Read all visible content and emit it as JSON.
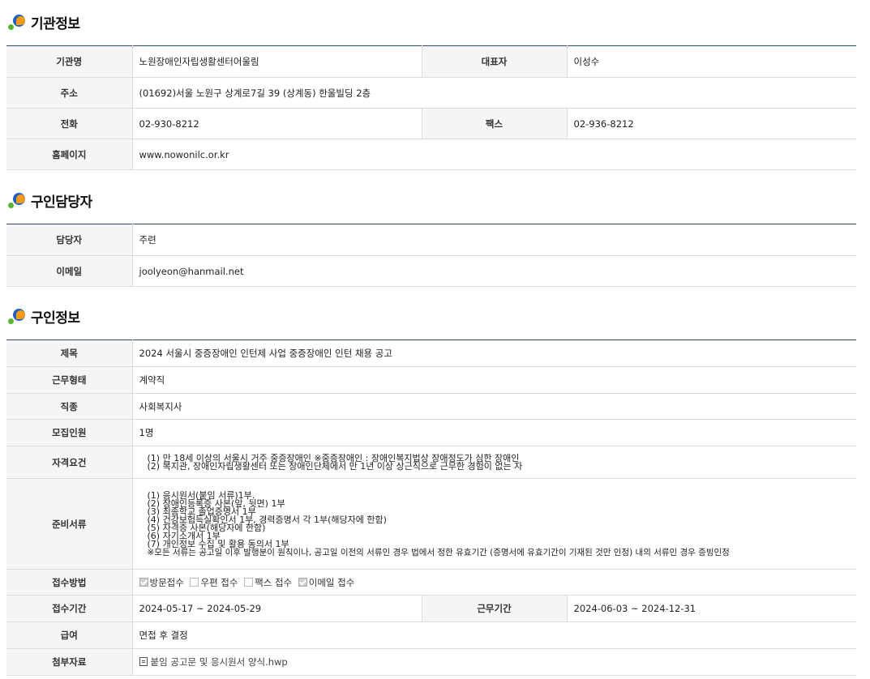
{
  "sections": {
    "agency": {
      "title": "기관정보",
      "rows": {
        "name_label": "기관명",
        "name": "노원장애인자립생활센터어울림",
        "rep_label": "대표자",
        "rep": "이성수",
        "address_label": "주소",
        "address": "(01692)서울 노원구 상계로7길 39 (상계동) 한울빌딩 2층",
        "phone_label": "전화",
        "phone": "02-930-8212",
        "fax_label": "팩스",
        "fax": "02-936-8212",
        "homepage_label": "홈페이지",
        "homepage": "www.nowonilc.or.kr"
      }
    },
    "contact": {
      "title": "구인담당자",
      "rows": {
        "person_label": "담당자",
        "person": "주련",
        "email_label": "이메일",
        "email": "joolyeon@hanmail.net"
      }
    },
    "job": {
      "title": "구인정보",
      "rows": {
        "title_label": "제목",
        "title": "2024 서울시 중증장애인 인턴제 사업 중증장애인 인턴 채용 공고",
        "type_label": "근무형태",
        "type": "계약직",
        "category_label": "직종",
        "category": "사회복지사",
        "count_label": "모집인원",
        "count": "1명",
        "qual_label": "자격요건",
        "qualifications": [
          "(1) 만 18세 이상의 서울시 거주 중증장애인 ※중증장애인 : 장애인복지법상 장애정도가 심한 장애인",
          "(2) 복지관, 장애인자립생활센터 또는 장애인단체에서 만 1년 이상 상근직으로 근무한 경험이 없는 자"
        ],
        "docs_label": "준비서류",
        "documents": [
          "(1) 응시원서(붙임 서류)1부.",
          "(2) 장애인등록증 사본(앞, 뒷면) 1부",
          "(3) 최종학교 졸업증명서 1부",
          "(4) 건강보험득실확인서 1부, 경력증명서 각 1부(해당자에 한함)",
          "(5) 자격증 사본(해당자에 한함)",
          "(6) 자기소개서 1부",
          "(7) 개인정보 수집 및 활용 동의서 1부",
          "※모든 서류는 공고일 이후 발행분이 원칙이나, 공고일 이전의 서류인 경우 법에서 정한 유효기간 (증명서에 유효기간이 기재된 것만 인정) 내의 서류인 경우 증빙인정"
        ],
        "method_label": "접수방법",
        "methods": {
          "visit": "방문접수",
          "mail": "우편 접수",
          "fax": "팩스 접수",
          "email": "이메일 접수"
        },
        "method_checked": {
          "visit": true,
          "mail": false,
          "fax": false,
          "email": true
        },
        "period_label": "접수기간",
        "period": "2024-05-17 ~ 2024-05-29",
        "work_label": "근무기간",
        "work": "2024-06-03 ~ 2024-12-31",
        "salary_label": "급여",
        "salary": "면접 후 결정",
        "attach_label": "첨부자료",
        "attachment": "붙임 공고문 및 응시원서 양식.hwp"
      }
    }
  },
  "colors": {
    "header_line": "#2b4a6f",
    "th_bg": "#f5f5f5",
    "border": "#dcdcdc"
  },
  "icons": {
    "section_bullet": "colored-dots-icon",
    "attachment": "file-icon",
    "checkbox": "checkbox-icon"
  }
}
